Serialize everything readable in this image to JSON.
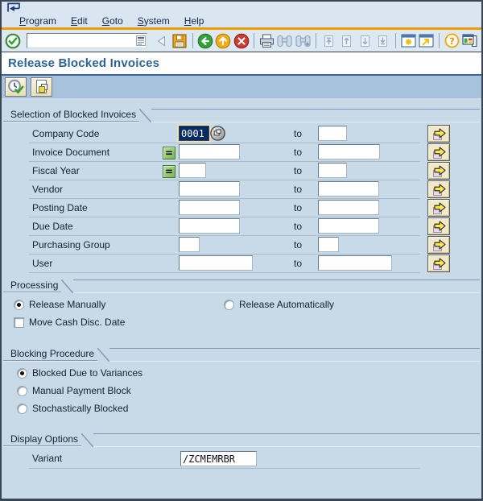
{
  "window": {
    "screen_icon": "screen-icon"
  },
  "menu_bar": {
    "items": [
      "Program",
      "Edit",
      "Goto",
      "System",
      "Help"
    ]
  },
  "toolbar": {
    "command_value": "",
    "items": [
      {
        "type": "button",
        "name": "enter-button",
        "icon": "enter-icon",
        "disabled": false
      },
      {
        "type": "command-field",
        "name": "command-field"
      },
      {
        "type": "button",
        "name": "collapse-command-field-button",
        "icon": "back-triangle-icon",
        "disabled": false
      },
      {
        "type": "button",
        "name": "save-button",
        "icon": "save-icon",
        "disabled": false
      },
      {
        "type": "separator"
      },
      {
        "type": "button",
        "name": "back-button",
        "icon": "back-icon",
        "disabled": false
      },
      {
        "type": "button",
        "name": "exit-button",
        "icon": "exit-icon",
        "disabled": false
      },
      {
        "type": "button",
        "name": "cancel-button",
        "icon": "cancel-icon",
        "disabled": false
      },
      {
        "type": "separator"
      },
      {
        "type": "button",
        "name": "print-button",
        "icon": "print-icon",
        "disabled": false
      },
      {
        "type": "button",
        "name": "find-button",
        "icon": "find-icon",
        "disabled": true
      },
      {
        "type": "button",
        "name": "find-next-button",
        "icon": "find-next-icon",
        "disabled": true
      },
      {
        "type": "separator"
      },
      {
        "type": "button",
        "name": "first-page-button",
        "icon": "first-page-icon",
        "disabled": true
      },
      {
        "type": "button",
        "name": "previous-page-button",
        "icon": "previous-page-icon",
        "disabled": true
      },
      {
        "type": "button",
        "name": "next-page-button",
        "icon": "next-page-icon",
        "disabled": true
      },
      {
        "type": "button",
        "name": "last-page-button",
        "icon": "last-page-icon",
        "disabled": true
      },
      {
        "type": "separator"
      },
      {
        "type": "button",
        "name": "new-session-button",
        "icon": "new-session-icon",
        "disabled": false
      },
      {
        "type": "button",
        "name": "create-shortcut-button",
        "icon": "shortcut-icon",
        "disabled": false
      },
      {
        "type": "separator"
      },
      {
        "type": "button",
        "name": "help-button",
        "icon": "help-icon",
        "disabled": false
      },
      {
        "type": "button",
        "name": "customize-layout-button",
        "icon": "customize-icon",
        "disabled": false
      }
    ]
  },
  "page": {
    "title": "Release Blocked Invoices"
  },
  "app_toolbar": {
    "buttons": [
      {
        "name": "execute-button",
        "icon": "execute-icon"
      },
      {
        "name": "get-variant-button",
        "icon": "get-variant-icon"
      }
    ]
  },
  "sections": {
    "selection": {
      "title": "Selection of Blocked Invoices",
      "to_label": "to",
      "rows": [
        {
          "label": "Company Code",
          "from_value": "0001",
          "to_value": "",
          "w1": 38,
          "w2": 36,
          "equals": false,
          "matchcode": true,
          "selected": true
        },
        {
          "label": "Invoice Document",
          "from_value": "",
          "to_value": "",
          "w1": 76,
          "w2": 77,
          "equals": true,
          "matchcode": false,
          "selected": false
        },
        {
          "label": "Fiscal Year",
          "from_value": "",
          "to_value": "",
          "w1": 34,
          "w2": 36,
          "equals": true,
          "matchcode": false,
          "selected": false
        },
        {
          "label": "Vendor",
          "from_value": "",
          "to_value": "",
          "w1": 76,
          "w2": 76,
          "equals": false,
          "matchcode": false,
          "selected": false
        },
        {
          "label": "Posting Date",
          "from_value": "",
          "to_value": "",
          "w1": 76,
          "w2": 76,
          "equals": false,
          "matchcode": false,
          "selected": false
        },
        {
          "label": "Due Date",
          "from_value": "",
          "to_value": "",
          "w1": 76,
          "w2": 76,
          "equals": false,
          "matchcode": false,
          "selected": false
        },
        {
          "label": "Purchasing Group",
          "from_value": "",
          "to_value": "",
          "w1": 26,
          "w2": 26,
          "equals": false,
          "matchcode": false,
          "selected": false
        },
        {
          "label": "User",
          "from_value": "",
          "to_value": "",
          "w1": 92,
          "w2": 92,
          "equals": false,
          "matchcode": false,
          "selected": false
        }
      ]
    },
    "processing": {
      "title": "Processing",
      "options": [
        {
          "label": "Release Manually",
          "selected": true
        },
        {
          "label": "Release Automatically",
          "selected": false
        }
      ],
      "checkboxes": [
        {
          "label": "Move Cash Disc. Date",
          "checked": false
        }
      ]
    },
    "blocking": {
      "title": "Blocking Procedure",
      "options": [
        {
          "label": "Blocked Due to Variances",
          "selected": true
        },
        {
          "label": "Manual Payment Block",
          "selected": false
        },
        {
          "label": "Stochastically Blocked",
          "selected": false
        }
      ]
    },
    "display": {
      "title": "Display Options",
      "rows": [
        {
          "label": "Variant",
          "value": "/ZCMEMRBR",
          "width": 95
        }
      ]
    }
  },
  "colors": {
    "window_bg": "#c8d9e8",
    "header_bg": "#d9e6f1",
    "orange_rule": "#ef9b00",
    "title_text": "#2e6397",
    "title_rule": "#3c639c",
    "app_toolbar_bg": "#a7c2dc",
    "group_line": "#7d97b5",
    "field_border": "#66788c",
    "selected_field_bg": "#082a63",
    "focus_ring": "#eee3b3",
    "button_face": "#f2e9c8",
    "equals_green": "#7ab457",
    "arrow_yellow": "#ffe94a"
  }
}
